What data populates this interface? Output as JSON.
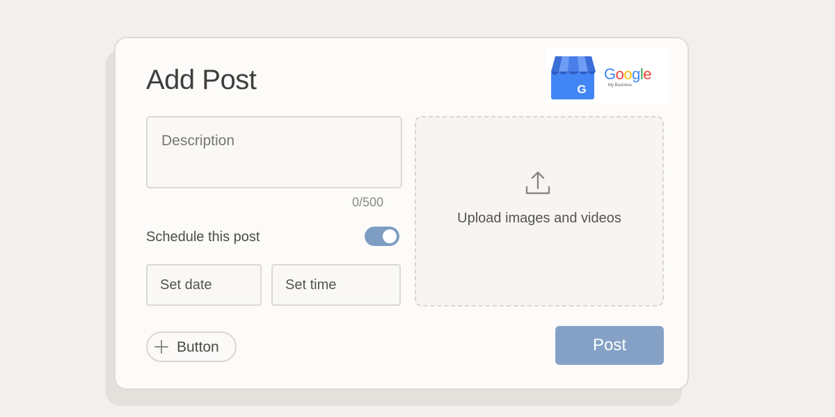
{
  "card": {
    "title": "Add Post"
  },
  "brand": {
    "logo_icon": "google-my-business-store-icon",
    "word_letters": [
      "G",
      "o",
      "o",
      "g",
      "l",
      "e"
    ],
    "word_colors": [
      "#4285F4",
      "#EA4335",
      "#FBBC05",
      "#4285F4",
      "#34A853",
      "#EA4335"
    ],
    "sub": "My Business"
  },
  "description": {
    "placeholder": "Description",
    "counter": "0/500"
  },
  "schedule": {
    "label": "Schedule this post",
    "enabled": true
  },
  "fields": {
    "date": "Set date",
    "time": "Set time"
  },
  "upload": {
    "icon": "upload-icon",
    "text": "Upload images and videos"
  },
  "actions": {
    "add_icon": "plus-icon",
    "add_label": "Button",
    "post_label": "Post"
  },
  "colors": {
    "accent": "#85A2C6",
    "toggle_on": "#7E9DC3",
    "background": "#F2F0EC"
  }
}
